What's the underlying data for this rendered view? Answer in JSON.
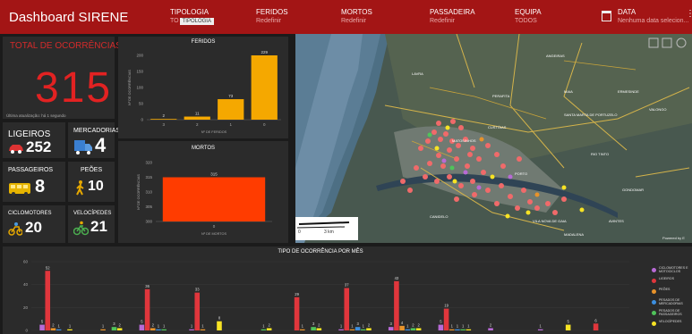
{
  "header": {
    "title": "Dashboard SIRENE",
    "filters": [
      {
        "label": "TIPOLOGIA",
        "value": "TO",
        "tooltip": "TIPOLOGIA"
      },
      {
        "label": "FERIDOS",
        "value": "Redefinir"
      },
      {
        "label": "MORTOS",
        "value": "Redefinir"
      },
      {
        "label": "PASSADEIRA",
        "value": "Redefinir"
      },
      {
        "label": "EQUIPA",
        "value": "TODOS"
      },
      {
        "label": "DATA",
        "value": "Nenhuma data selecion..."
      }
    ],
    "calendar_icon": "calendar-icon",
    "menu_icon": "more-menu-icon"
  },
  "total": {
    "title": "TOTAL DE OCORRÊNCIAS",
    "value": "315",
    "updated": "Última atualização: há 1 segundo"
  },
  "categories": [
    {
      "name": "LIGEIROS",
      "value": "252",
      "icon": "car-icon",
      "color": "#d33"
    },
    {
      "name": "MERCADORIAS",
      "value": "4",
      "icon": "truck-icon",
      "color": "#3a7fd1"
    },
    {
      "name": "PASSAGEIROS",
      "value": "8",
      "icon": "bus-icon",
      "color": "#e6b400"
    },
    {
      "name": "PEÕES",
      "value": "10",
      "icon": "pedestrian-icon",
      "color": "#e6a800"
    },
    {
      "name": "CICLOMOTORES",
      "value": "20",
      "icon": "motorbike-icon",
      "color": "#e6a800"
    },
    {
      "name": "VELOCÍPEDES",
      "value": "21",
      "icon": "bicycle-icon",
      "color": "#4caf50"
    }
  ],
  "feridos_chart": {
    "title": "FERIDOS",
    "type": "bar",
    "xlabel": "Nº DE FERIDOS",
    "ylabel": "Nº DE OCORRÊNCIAS",
    "categories": [
      "3",
      "2",
      "1",
      "0"
    ],
    "values": [
      2,
      11,
      73,
      229
    ],
    "yticks": [
      "0",
      "50",
      "100",
      "150",
      "200"
    ],
    "ylim": [
      0,
      229
    ],
    "color": "#f5a800"
  },
  "mortos_chart": {
    "title": "MORTOS",
    "type": "bar",
    "xlabel": "Nº DE MORTOS",
    "ylabel": "Nº DE OCORRÊNCIAS",
    "categories": [
      "0"
    ],
    "values": [
      315
    ],
    "yticks": [
      "300",
      "305",
      "310",
      "315",
      "320"
    ],
    "ylim": [
      300,
      320
    ],
    "color": "#ff3c00"
  },
  "map": {
    "scale_left": "0",
    "scale_right": "3 km",
    "attribution": "Powered by E",
    "place_labels": [
      "ANGEIRAS",
      "LAVRA",
      "MAIA",
      "MATOSINHOS",
      "CUSTÓIAS",
      "SANTA MARTA DE PORTUZELO",
      "RIO TINTO",
      "VALONGO",
      "ERMESINDE",
      "PORTO",
      "GONDOMAR",
      "VILA NOVA DE GAIA",
      "CANIDELO",
      "AVINTES",
      "MADALENA",
      "PERAFITA"
    ]
  },
  "monthly_chart": {
    "title": "TIPO DE OCORRÊNCIA POR MÊS",
    "type": "bar",
    "yticks": [
      "0",
      "20",
      "40",
      "60"
    ],
    "ylim": [
      0,
      60
    ],
    "series": [
      {
        "name": "CICLOMOTORES E MOTOCICLOS",
        "color": "#b86ad6",
        "values": [
          5,
          0,
          5,
          1,
          0,
          0,
          1,
          3,
          5,
          2,
          1,
          0
        ]
      },
      {
        "name": "LIGEIROS",
        "color": "#e0363c",
        "values": [
          52,
          0,
          36,
          33,
          0,
          29,
          37,
          43,
          19,
          0,
          0,
          6
        ]
      },
      {
        "name": "PEÕES",
        "color": "#e8932a",
        "values": [
          2,
          1,
          2,
          1,
          0,
          1,
          1,
          4,
          1,
          0,
          0,
          0
        ]
      },
      {
        "name": "PESADOS DE MERCADORIAS",
        "color": "#3c8fe0",
        "values": [
          1,
          0,
          1,
          0,
          0,
          0,
          3,
          1,
          1,
          0,
          0,
          0
        ]
      },
      {
        "name": "PESADOS DE PASSAGEIROS",
        "color": "#4fc35a",
        "values": [
          0,
          3,
          1,
          0,
          1,
          3,
          1,
          2,
          1,
          0,
          0,
          0
        ]
      },
      {
        "name": "VELOCÍPEDES",
        "color": "#f7e324",
        "values": [
          1,
          2,
          0,
          8,
          2,
          2,
          2,
          2,
          1,
          0,
          5,
          0
        ]
      }
    ]
  }
}
